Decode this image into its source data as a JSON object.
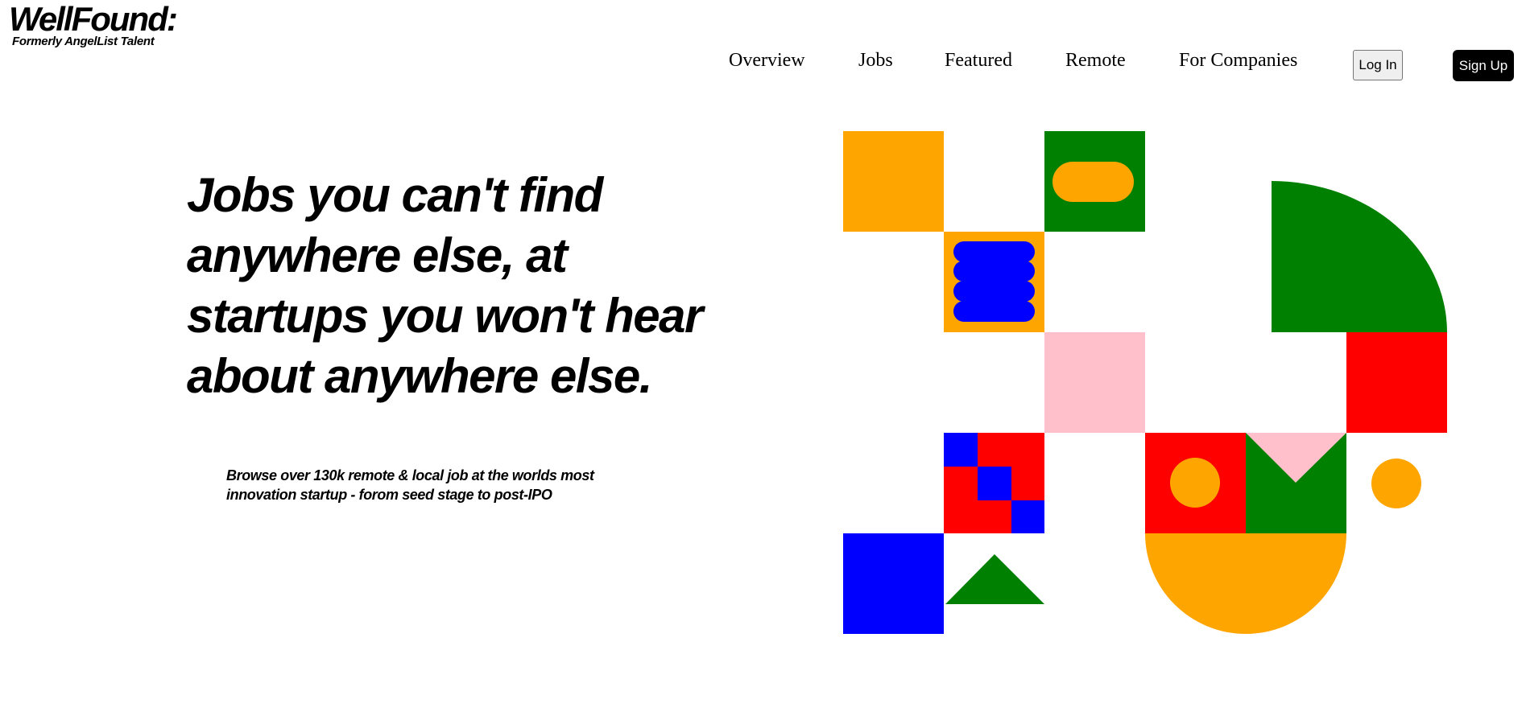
{
  "brand": {
    "logo": "WellFound:",
    "tagline": "Formerly AngelList Talent"
  },
  "nav": {
    "items": [
      "Overview",
      "Jobs",
      "Featured",
      "Remote",
      "For Companies"
    ],
    "login_label": "Log In",
    "signup_label": "Sign Up"
  },
  "hero": {
    "title": "Jobs you can't find anywhere else, at startups you won't hear about anywhere else.",
    "subtitle": "Browse over 130k remote & local job at the worlds most innovation startup - forom seed stage to post-IPO"
  },
  "colors": {
    "orange": "#FFA500",
    "green": "#008000",
    "blue": "#0000FF",
    "red": "#FF0000",
    "pink": "#FFC0CB",
    "black": "#000000",
    "white": "#FFFFFF"
  }
}
